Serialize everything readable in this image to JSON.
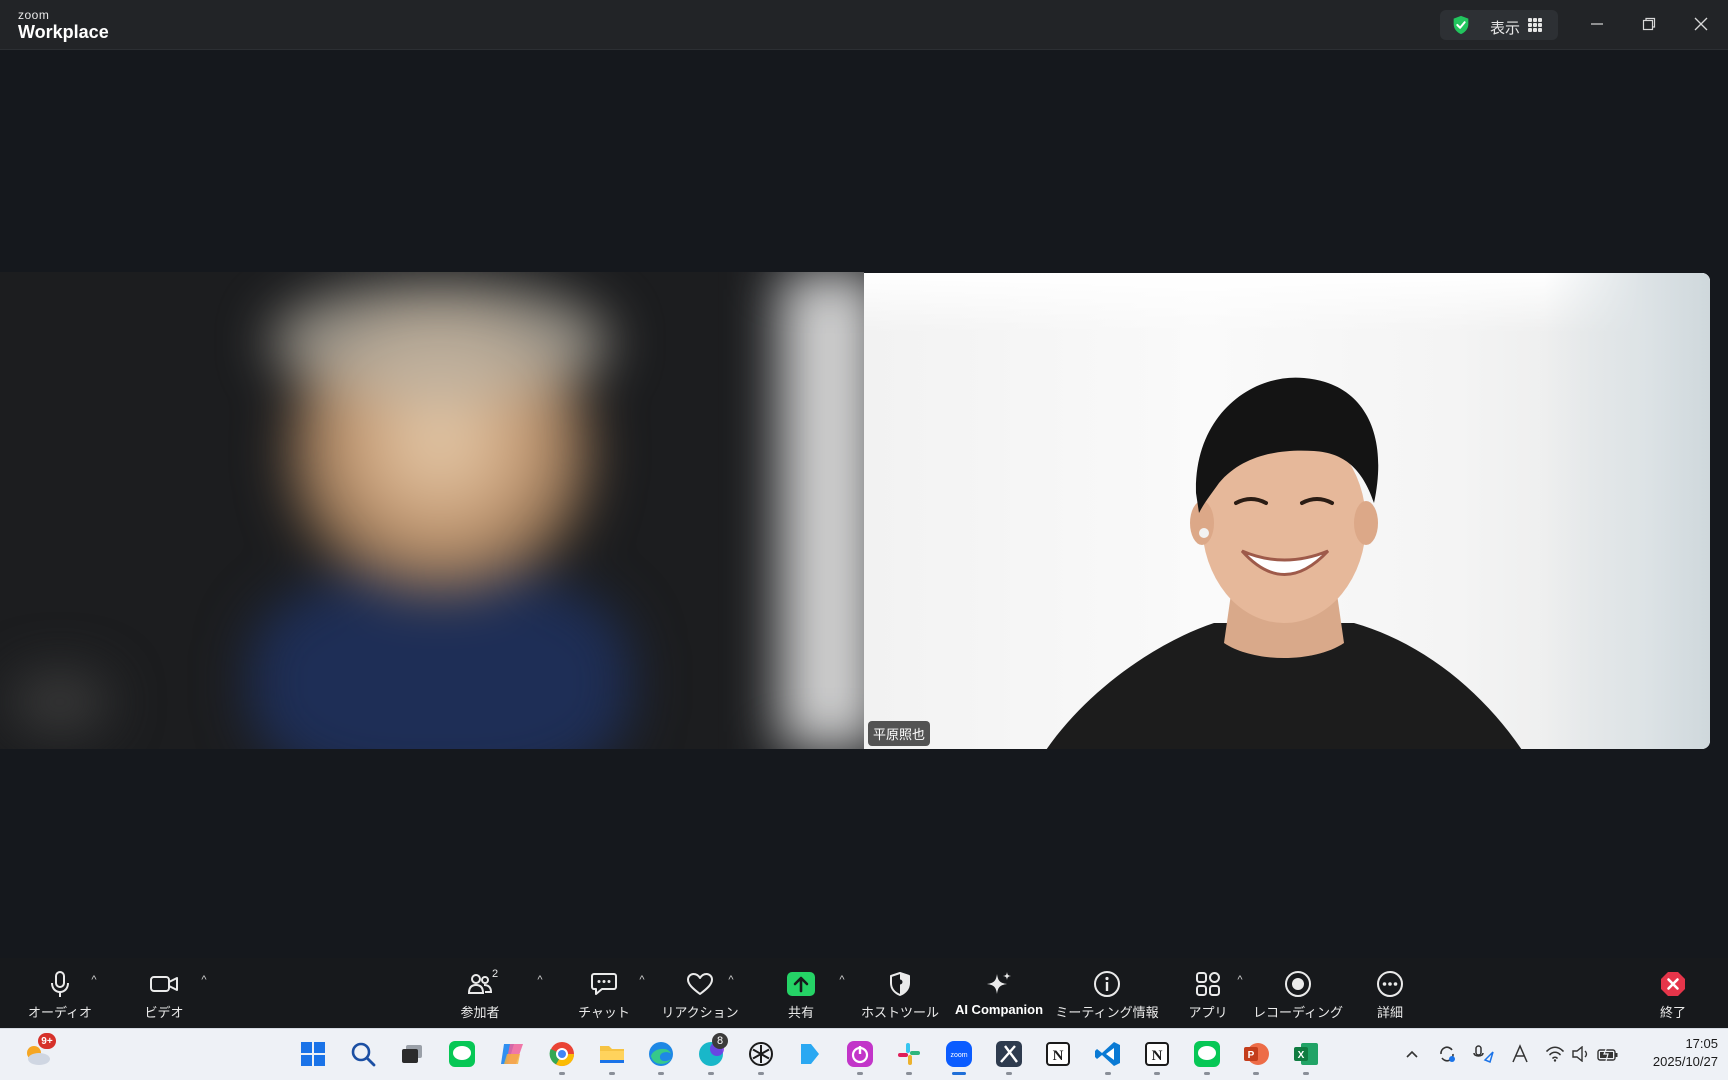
{
  "window": {
    "logo_small": "zoom",
    "logo_big": "Workplace",
    "view_label": "表示"
  },
  "meeting": {
    "participant_name": "平原照也"
  },
  "toolbar": {
    "audio": "オーディオ",
    "video": "ビデオ",
    "participants": "参加者",
    "participants_count": "2",
    "chat": "チャット",
    "reactions": "リアクション",
    "share": "共有",
    "host_tools": "ホストツール",
    "ai_companion": "AI Companion",
    "meeting_info": "ミーティング情報",
    "apps": "アプリ",
    "recording": "レコーディング",
    "more": "詳細",
    "end": "終了"
  },
  "taskbar": {
    "weather_badge": "9+",
    "canva_badge": "8",
    "time": "17:05",
    "date": "2025/10/27"
  },
  "colors": {
    "share_green": "#25d366",
    "end_red": "#e5354a",
    "shield_green": "#22c55e",
    "taskbar_active": "#1f6fd8"
  }
}
